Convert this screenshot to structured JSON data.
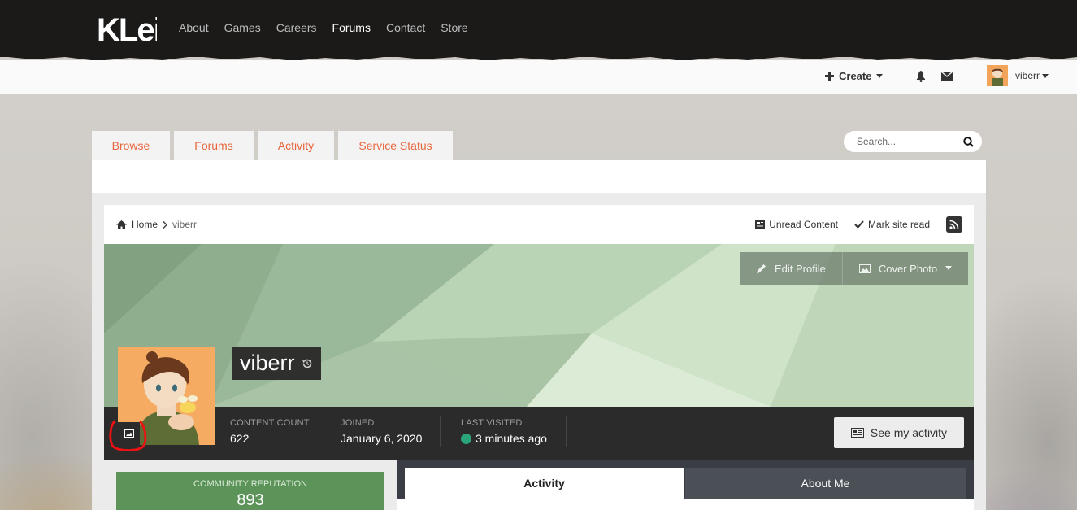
{
  "site": {
    "logo_text": "KLei",
    "nav": [
      {
        "label": "About",
        "active": false
      },
      {
        "label": "Games",
        "active": false
      },
      {
        "label": "Careers",
        "active": false
      },
      {
        "label": "Forums",
        "active": true
      },
      {
        "label": "Contact",
        "active": false
      },
      {
        "label": "Store",
        "active": false
      }
    ]
  },
  "userbar": {
    "create_label": "Create",
    "username": "viberr",
    "icons": [
      "plus-icon",
      "bell-icon",
      "envelope-icon",
      "caret-down-icon"
    ]
  },
  "subnav": {
    "tabs": [
      "Browse",
      "Forums",
      "Activity",
      "Service Status"
    ],
    "search_placeholder": "Search..."
  },
  "breadcrumb": {
    "home": "Home",
    "current": "viberr",
    "unread": "Unread Content",
    "mark_read": "Mark site read"
  },
  "profile": {
    "name": "viberr",
    "edit_label": "Edit Profile",
    "cover_label": "Cover Photo",
    "stats": {
      "content_count_label": "CONTENT COUNT",
      "content_count": "622",
      "joined_label": "JOINED",
      "joined": "January 6, 2020",
      "last_visited_label": "LAST VISITED",
      "last_visited": "3 minutes ago"
    },
    "see_activity": "See my activity",
    "reputation_label": "COMMUNITY REPUTATION",
    "reputation": "893",
    "tabs": [
      "Activity",
      "About Me"
    ]
  },
  "colors": {
    "accent": "#e8663d",
    "reputation_green": "#5b9359",
    "online": "#2aa57a",
    "topbar": "#1b1a19"
  }
}
